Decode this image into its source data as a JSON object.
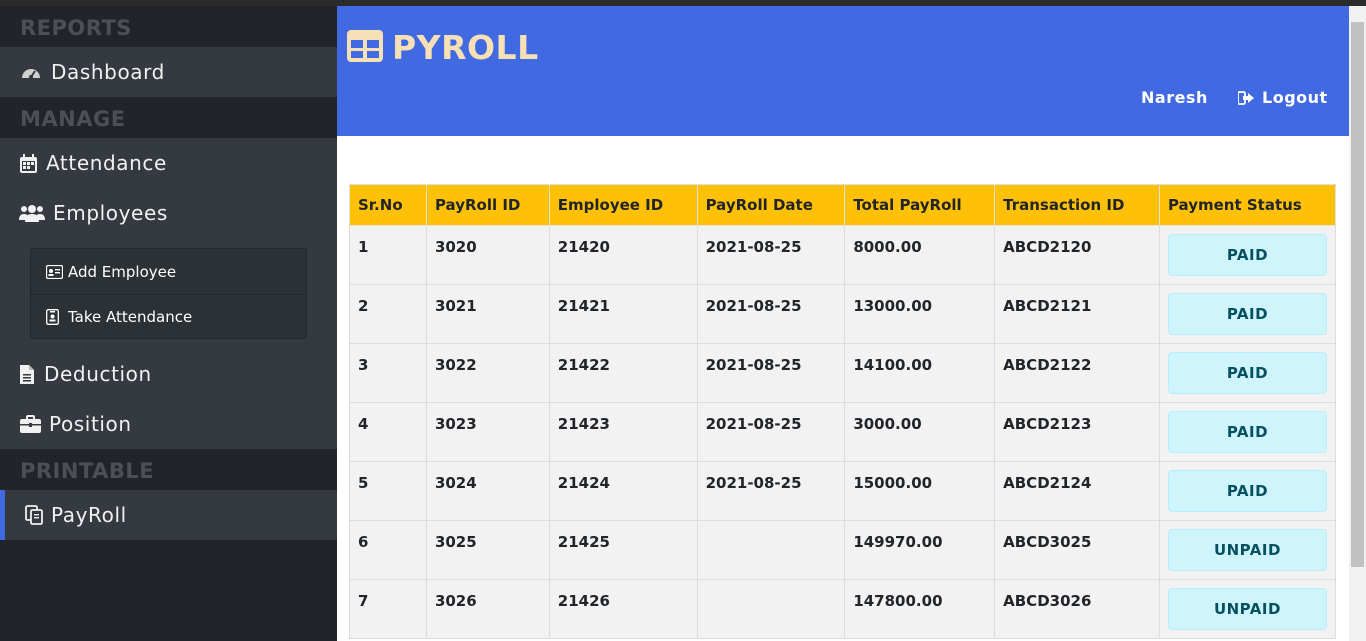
{
  "sidebar": {
    "sections": {
      "reports": "REPORTS",
      "manage": "MANAGE",
      "printable": "PRINTABLE"
    },
    "items": {
      "dashboard": "Dashboard",
      "attendance": "Attendance",
      "employees": "Employees",
      "add_employee": "Add Employee",
      "take_attendance": "Take Attendance",
      "deduction": "Deduction",
      "position": "Position",
      "payroll": "PayRoll"
    }
  },
  "header": {
    "brand": "PYROLL",
    "user": "Naresh",
    "logout": "Logout"
  },
  "table": {
    "headers": [
      "Sr.No",
      "PayRoll ID",
      "Employee ID",
      "PayRoll Date",
      "Total PayRoll",
      "Transaction ID",
      "Payment Status"
    ],
    "rows": [
      {
        "sr": "1",
        "payroll_id": "3020",
        "employee_id": "21420",
        "date": "2021-08-25",
        "total": "8000.00",
        "txn": "ABCD2120",
        "status": "PAID"
      },
      {
        "sr": "2",
        "payroll_id": "3021",
        "employee_id": "21421",
        "date": "2021-08-25",
        "total": "13000.00",
        "txn": "ABCD2121",
        "status": "PAID"
      },
      {
        "sr": "3",
        "payroll_id": "3022",
        "employee_id": "21422",
        "date": "2021-08-25",
        "total": "14100.00",
        "txn": "ABCD2122",
        "status": "PAID"
      },
      {
        "sr": "4",
        "payroll_id": "3023",
        "employee_id": "21423",
        "date": "2021-08-25",
        "total": "3000.00",
        "txn": "ABCD2123",
        "status": "PAID"
      },
      {
        "sr": "5",
        "payroll_id": "3024",
        "employee_id": "21424",
        "date": "2021-08-25",
        "total": "15000.00",
        "txn": "ABCD2124",
        "status": "PAID"
      },
      {
        "sr": "6",
        "payroll_id": "3025",
        "employee_id": "21425",
        "date": "",
        "total": "149970.00",
        "txn": "ABCD3025",
        "status": "UNPAID"
      },
      {
        "sr": "7",
        "payroll_id": "3026",
        "employee_id": "21426",
        "date": "",
        "total": "147800.00",
        "txn": "ABCD3026",
        "status": "UNPAID"
      }
    ]
  },
  "colors": {
    "header_bg": "#4169e1",
    "brand_text": "#f7e0b6",
    "table_head": "#ffc107",
    "badge_bg": "#cff4fc",
    "badge_text": "#055160",
    "sidebar_bg": "#212529",
    "sidebar_item_bg": "#343a40"
  }
}
